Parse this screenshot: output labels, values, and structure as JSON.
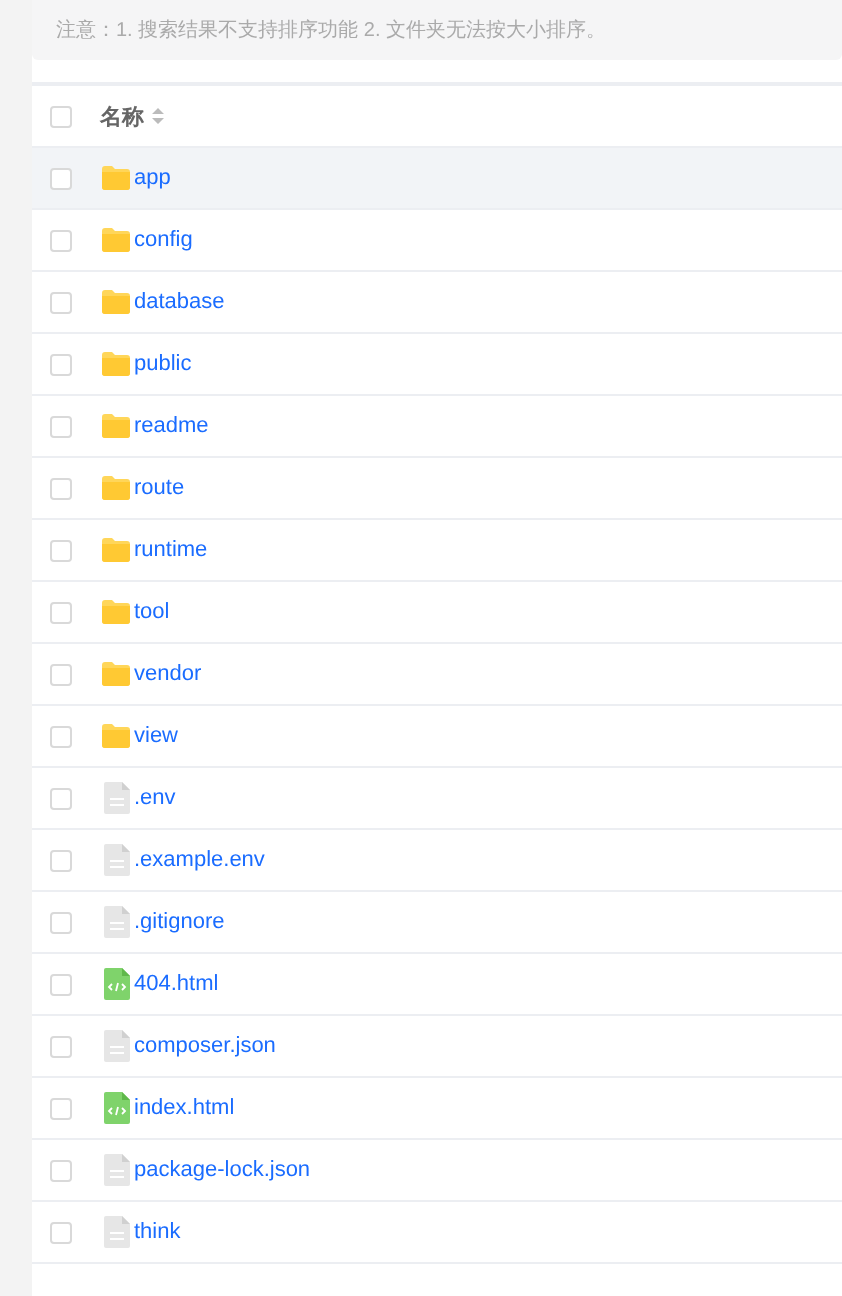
{
  "notice": "注意：1. 搜索结果不支持排序功能 2. 文件夹无法按大小排序。",
  "header": {
    "column": "名称",
    "checked": false
  },
  "rows": [
    {
      "name": "app",
      "kind": "folder",
      "checked": false,
      "highlighted": true
    },
    {
      "name": "config",
      "kind": "folder",
      "checked": false,
      "highlighted": false
    },
    {
      "name": "database",
      "kind": "folder",
      "checked": false,
      "highlighted": false
    },
    {
      "name": "public",
      "kind": "folder",
      "checked": false,
      "highlighted": false
    },
    {
      "name": "readme",
      "kind": "folder",
      "checked": false,
      "highlighted": false
    },
    {
      "name": "route",
      "kind": "folder",
      "checked": false,
      "highlighted": false
    },
    {
      "name": "runtime",
      "kind": "folder",
      "checked": false,
      "highlighted": false
    },
    {
      "name": "tool",
      "kind": "folder",
      "checked": false,
      "highlighted": false
    },
    {
      "name": "vendor",
      "kind": "folder",
      "checked": false,
      "highlighted": false
    },
    {
      "name": "view",
      "kind": "folder",
      "checked": false,
      "highlighted": false
    },
    {
      "name": ".env",
      "kind": "file",
      "checked": false,
      "highlighted": false
    },
    {
      "name": ".example.env",
      "kind": "file",
      "checked": false,
      "highlighted": false
    },
    {
      "name": ".gitignore",
      "kind": "file",
      "checked": false,
      "highlighted": false
    },
    {
      "name": "404.html",
      "kind": "html",
      "checked": false,
      "highlighted": false
    },
    {
      "name": "composer.json",
      "kind": "file",
      "checked": false,
      "highlighted": false
    },
    {
      "name": "index.html",
      "kind": "html",
      "checked": false,
      "highlighted": false
    },
    {
      "name": "package-lock.json",
      "kind": "file",
      "checked": false,
      "highlighted": false
    },
    {
      "name": "think",
      "kind": "file",
      "checked": false,
      "highlighted": false
    }
  ]
}
